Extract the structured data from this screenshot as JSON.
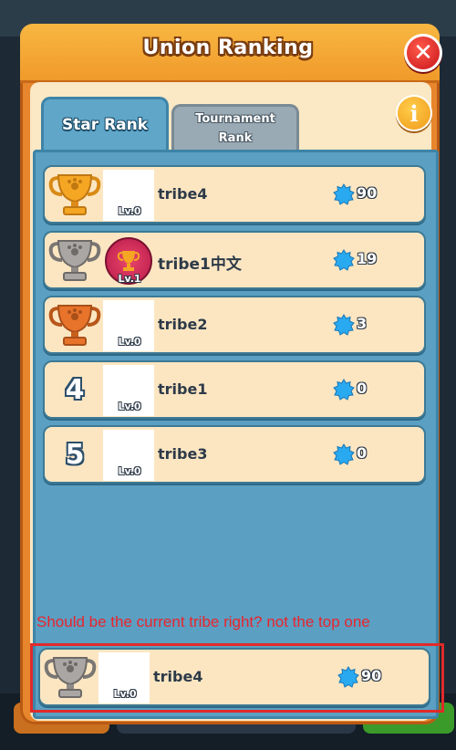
{
  "window": {
    "title": "Union Ranking",
    "close_label": "✕",
    "info_label": "i"
  },
  "tabs": [
    {
      "label": "Star Rank",
      "active": true
    },
    {
      "label_line1": "Tournament",
      "label_line2": "Rank",
      "active": false
    }
  ],
  "rows": [
    {
      "rank": "1",
      "trophy": "gold-trophy-icon",
      "name": "tribe4",
      "level": "Lv.0",
      "stars": "90"
    },
    {
      "rank": "2",
      "trophy": "silver-trophy-icon",
      "name": "tribe1中文",
      "level": "Lv.1",
      "stars": "19"
    },
    {
      "rank": "3",
      "trophy": "bronze-trophy-icon",
      "name": "tribe2",
      "level": "Lv.0",
      "stars": "3"
    },
    {
      "rank": "4",
      "name": "tribe1",
      "level": "Lv.0",
      "stars": "0"
    },
    {
      "rank": "5",
      "name": "tribe3",
      "level": "Lv.0",
      "stars": "0"
    }
  ],
  "current": {
    "name": "tribe4",
    "level": "Lv.0",
    "stars": "90",
    "trophy": "silver-trophy-icon"
  },
  "annotation": "Should be the current tribe right? not the top one",
  "colors": {
    "gold": "#f5a623",
    "silver": "#a9a6a3",
    "bronze": "#e8732a",
    "star": "#29a9f0",
    "annotation": "#e8252e"
  }
}
